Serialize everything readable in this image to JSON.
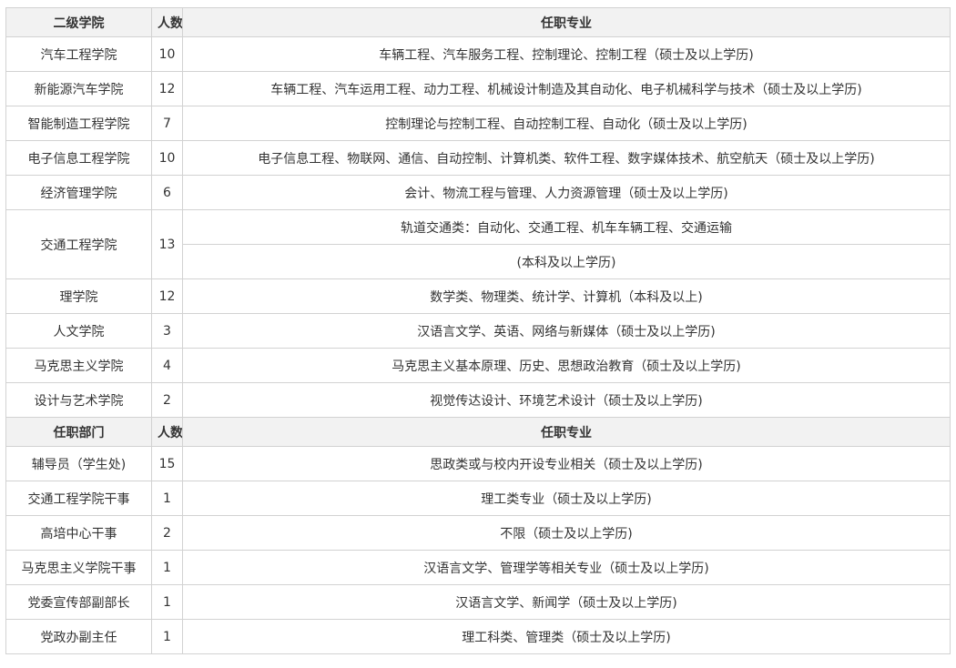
{
  "section1": {
    "headers": [
      "二级学院",
      "人数",
      "任职专业"
    ],
    "rows": [
      {
        "name": "汽车工程学院",
        "count": "10",
        "majors": "车辆工程、汽车服务工程、控制理论、控制工程（硕士及以上学历)"
      },
      {
        "name": "新能源汽车学院",
        "count": "12",
        "majors": "车辆工程、汽车运用工程、动力工程、机械设计制造及其自动化、电子机械科学与技术（硕士及以上学历)"
      },
      {
        "name": "智能制造工程学院",
        "count": "7",
        "majors": "控制理论与控制工程、自动控制工程、自动化（硕士及以上学历)"
      },
      {
        "name": "电子信息工程学院",
        "count": "10",
        "majors": "电子信息工程、物联网、通信、自动控制、计算机类、软件工程、数字媒体技术、航空航天（硕士及以上学历)"
      },
      {
        "name": "经济管理学院",
        "count": "6",
        "majors": "会计、物流工程与管理、人力资源管理（硕士及以上学历)"
      }
    ],
    "traffic": {
      "name": "交通工程学院",
      "count": "13",
      "majors_line1": "轨道交通类：自动化、交通工程、机车车辆工程、交通运输",
      "majors_line2": "(本科及以上学历)"
    },
    "rows2": [
      {
        "name": "理学院",
        "count": "12",
        "majors": "数学类、物理类、统计学、计算机（本科及以上)"
      },
      {
        "name": "人文学院",
        "count": "3",
        "majors": "汉语言文学、英语、网络与新媒体（硕士及以上学历)"
      },
      {
        "name": "马克思主义学院",
        "count": "4",
        "majors": "马克思主义基本原理、历史、思想政治教育（硕士及以上学历)"
      },
      {
        "name": "设计与艺术学院",
        "count": "2",
        "majors": "视觉传达设计、环境艺术设计（硕士及以上学历)"
      }
    ]
  },
  "section2": {
    "headers": [
      "任职部门",
      "人数",
      "任职专业"
    ],
    "rows": [
      {
        "name": "辅导员（学生处)",
        "count": "15",
        "majors": "思政类或与校内开设专业相关（硕士及以上学历)"
      },
      {
        "name": "交通工程学院干事",
        "count": "1",
        "majors": "理工类专业（硕士及以上学历)"
      },
      {
        "name": "高培中心干事",
        "count": "2",
        "majors": "不限（硕士及以上学历)"
      },
      {
        "name": "马克思主义学院干事",
        "count": "1",
        "majors": "汉语言文学、管理学等相关专业（硕士及以上学历)"
      },
      {
        "name": "党委宣传部副部长",
        "count": "1",
        "majors": "汉语言文学、新闻学（硕士及以上学历)"
      },
      {
        "name": "党政办副主任",
        "count": "1",
        "majors": "理工科类、管理类（硕士及以上学历)"
      }
    ]
  }
}
